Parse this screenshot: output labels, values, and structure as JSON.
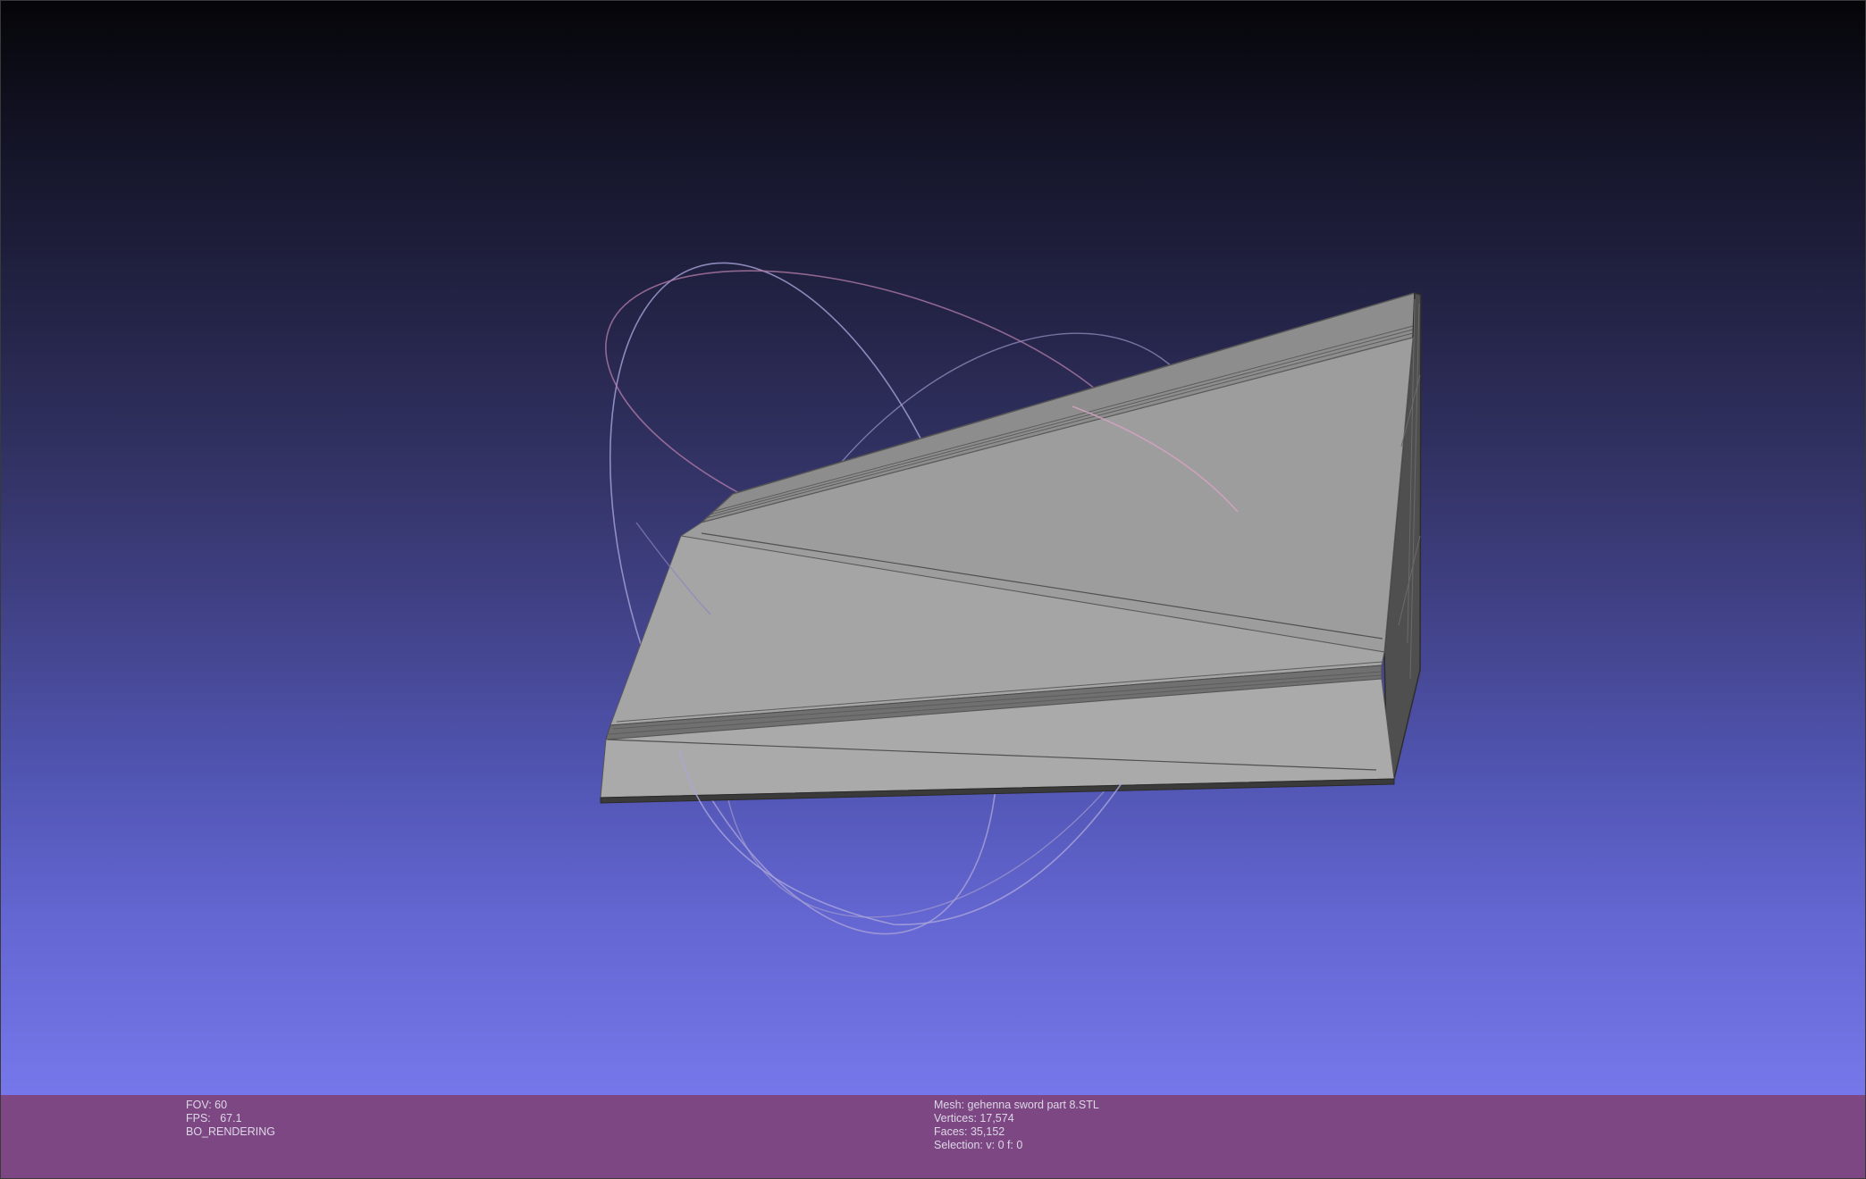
{
  "viewer": {
    "render_info": {
      "fov": "FOV: 60",
      "fps": "FPS:   67.1",
      "mode": "BO_RENDERING"
    },
    "mesh_info": {
      "mesh": "Mesh: gehenna sword part 8.STL",
      "vertices": "Vertices: 17,574",
      "faces": "Faces: 35,152",
      "selection": "Selection: v: 0 f: 0"
    }
  },
  "colors": {
    "statusbar_bg": "#7d4784",
    "background_top": "#050508",
    "background_bottom": "#7677ea",
    "mesh_light": "#a8a8a8",
    "mesh_dark": "#8e8e8e"
  }
}
